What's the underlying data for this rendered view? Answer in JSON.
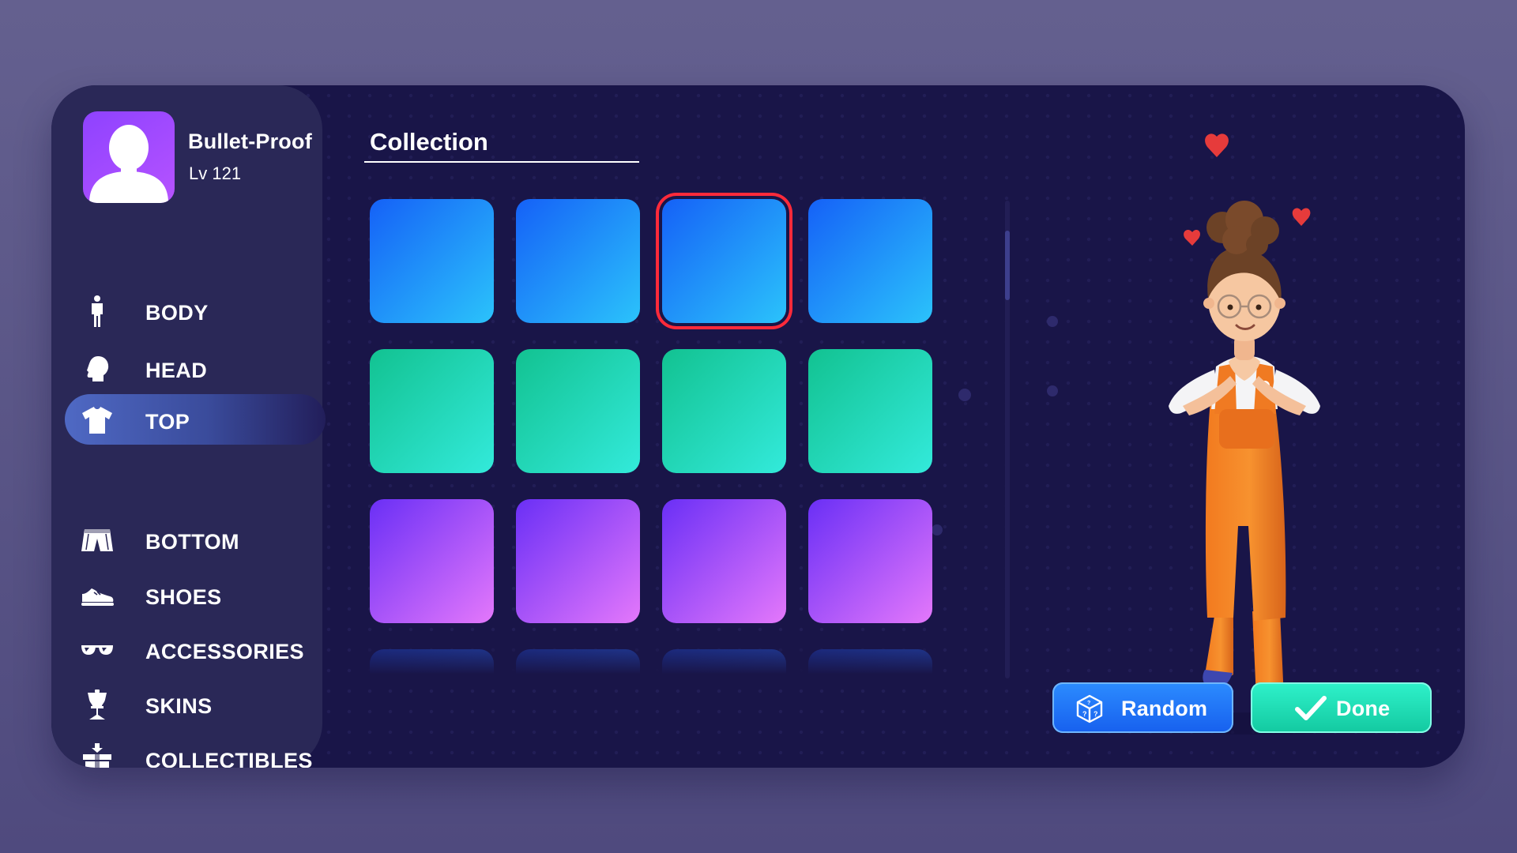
{
  "profile": {
    "name": "Bullet-Proof",
    "level": "Lv 121"
  },
  "nav": {
    "items": [
      {
        "id": "body",
        "label": "BODY",
        "icon": "body-figure-icon",
        "active": false
      },
      {
        "id": "head",
        "label": "HEAD",
        "icon": "head-icon",
        "active": false
      },
      {
        "id": "top",
        "label": "TOP",
        "icon": "tshirt-icon",
        "active": true
      },
      {
        "id": "bottom",
        "label": "BOTTOM",
        "icon": "shorts-icon",
        "active": false
      },
      {
        "id": "shoes",
        "label": "SHOES",
        "icon": "shoe-icon",
        "active": false
      },
      {
        "id": "accessories",
        "label": "ACCESSORIES",
        "icon": "sunglasses-icon",
        "active": false
      },
      {
        "id": "skins",
        "label": "SKINS",
        "icon": "mannequin-icon",
        "active": false
      },
      {
        "id": "collectibles",
        "label": "COLLECTIBLES",
        "icon": "gift-box-icon",
        "active": false
      }
    ]
  },
  "collection": {
    "title": "Collection",
    "selected_index": 2,
    "tiles": [
      {
        "color_from": "#1561f7",
        "color_to": "#2bc3fb"
      },
      {
        "color_from": "#1561f7",
        "color_to": "#2bc3fb"
      },
      {
        "color_from": "#1561f7",
        "color_to": "#2bc3fb"
      },
      {
        "color_from": "#1561f7",
        "color_to": "#2bc3fb"
      },
      {
        "color_from": "#12c291",
        "color_to": "#33eadb"
      },
      {
        "color_from": "#12c291",
        "color_to": "#33eadb"
      },
      {
        "color_from": "#12c291",
        "color_to": "#33eadb"
      },
      {
        "color_from": "#12c291",
        "color_to": "#33eadb"
      },
      {
        "color_from": "#6a2ff6",
        "color_to": "#e478fb"
      },
      {
        "color_from": "#6a2ff6",
        "color_to": "#e478fb"
      },
      {
        "color_from": "#6a2ff6",
        "color_to": "#e478fb"
      },
      {
        "color_from": "#6a2ff6",
        "color_to": "#e478fb"
      },
      {
        "color_from": "#1d3aa8",
        "color_to": "#2a5fd0"
      },
      {
        "color_from": "#1d3aa8",
        "color_to": "#2a5fd0"
      },
      {
        "color_from": "#1d3aa8",
        "color_to": "#2a5fd0"
      },
      {
        "color_from": "#1d3aa8",
        "color_to": "#2a5fd0"
      }
    ]
  },
  "actions": {
    "random_label": "Random",
    "random_icon": "dice-box-icon",
    "done_label": "Done",
    "done_icon": "checkmark-icon"
  },
  "colors": {
    "background": "#5a5689",
    "panel": "#191548",
    "sidebar": "#2a2857",
    "selection": "#ff2a3a",
    "random_button": "#1d6ff5",
    "done_button": "#1bd8ad",
    "avatar": "#9d4bff"
  }
}
